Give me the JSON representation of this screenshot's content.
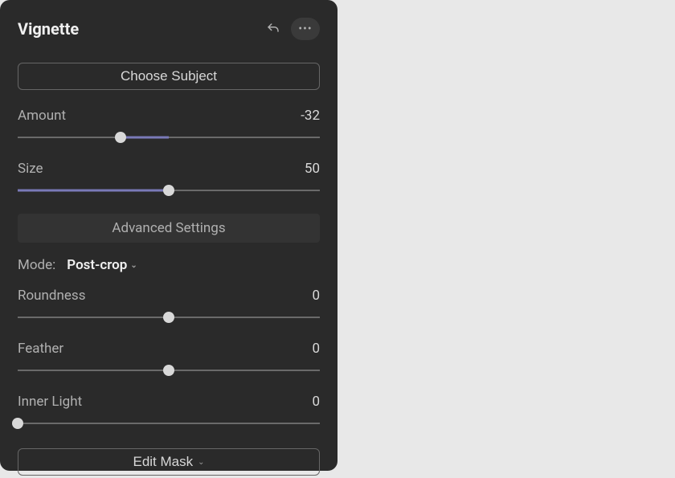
{
  "header": {
    "title": "Vignette"
  },
  "choose_subject": {
    "label": "Choose Subject"
  },
  "sliders": {
    "amount": {
      "label": "Amount",
      "value": "-32",
      "min": -100,
      "max": 100,
      "pos": 34,
      "fillLeft": 34,
      "fillWidth": 16
    },
    "size": {
      "label": "Size",
      "value": "50",
      "min": 0,
      "max": 100,
      "pos": 50,
      "fillLeft": 0,
      "fillWidth": 50
    },
    "roundness": {
      "label": "Roundness",
      "value": "0",
      "min": -100,
      "max": 100,
      "pos": 50,
      "fillLeft": 50,
      "fillWidth": 0
    },
    "feather": {
      "label": "Feather",
      "value": "0",
      "min": -100,
      "max": 100,
      "pos": 50,
      "fillLeft": 50,
      "fillWidth": 0
    },
    "inner_light": {
      "label": "Inner Light",
      "value": "0",
      "min": 0,
      "max": 100,
      "pos": 0,
      "fillLeft": 0,
      "fillWidth": 0
    }
  },
  "advanced": {
    "label": "Advanced Settings"
  },
  "mode": {
    "label": "Mode:",
    "selected": "Post-crop"
  },
  "edit_mask": {
    "label": "Edit Mask"
  }
}
